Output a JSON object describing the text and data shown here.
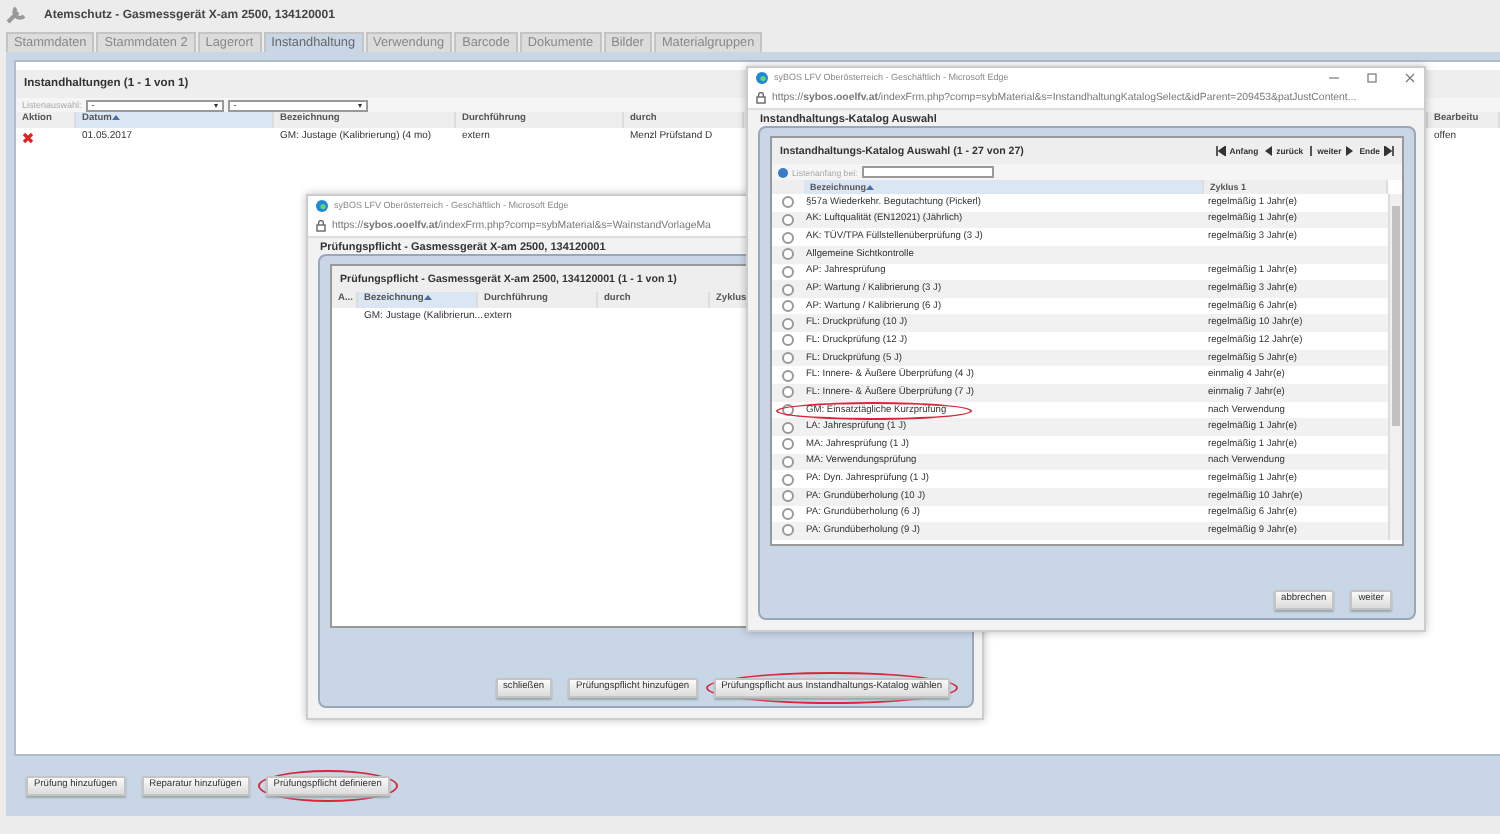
{
  "page": {
    "title": "Atemschutz - Gasmessgerät X-am 2500, 134120001"
  },
  "tabs": [
    {
      "label": "Stammdaten",
      "selected": false
    },
    {
      "label": "Stammdaten 2",
      "selected": false
    },
    {
      "label": "Lagerort",
      "selected": false
    },
    {
      "label": "Instandhaltung",
      "selected": true
    },
    {
      "label": "Verwendung",
      "selected": false
    },
    {
      "label": "Barcode",
      "selected": false
    },
    {
      "label": "Dokumente",
      "selected": false
    },
    {
      "label": "Bilder",
      "selected": false
    },
    {
      "label": "Materialgruppen",
      "selected": false
    }
  ],
  "maintenance": {
    "title": "Instandhaltungen (1 - 1 von 1)",
    "filter_label": "Listenauswahl:",
    "filter_1": "-",
    "filter_2": "-",
    "columns": [
      {
        "label": "Aktion",
        "sorted": false
      },
      {
        "label": "Datum",
        "sorted": true
      },
      {
        "label": "Bezeichnung",
        "sorted": false
      },
      {
        "label": "Durchführung",
        "sorted": false
      },
      {
        "label": "durch",
        "sorted": false
      },
      {
        "label": "Bearbeitu",
        "sorted": false
      }
    ],
    "rows": [
      {
        "datum": "01.05.2017",
        "bezeichnung": "GM: Justage (Kalibrierung) (4 mo)",
        "durchfuehrung": "extern",
        "durch": "Menzl Prüfstand D",
        "bearbeitung": "offen"
      }
    ]
  },
  "buttons": [
    {
      "label": "Prüfung hinzufügen",
      "highlighted": false
    },
    {
      "label": "Reparatur hinzufügen",
      "highlighted": false
    },
    {
      "label": "Prüfungspflicht definieren",
      "highlighted": true
    }
  ],
  "duty_window": {
    "title": "syBOS LFV Oberösterreich - Geschäftlich - Microsoft Edge",
    "url": "https://**sybos.ooelfv.at**/indexFrm.php?comp=sybMaterial&s=WainstandVorlageMa",
    "legend": "Prüfungspflicht - Gasmessgerät X-am 2500, 134120001",
    "list_title": "Prüfungspflicht - Gasmessgerät X-am 2500, 134120001 (1 - 1 von 1)",
    "columns": [
      {
        "label": "A...",
        "sorted": false
      },
      {
        "label": "Bezeichnung",
        "sorted": true
      },
      {
        "label": "Durchführung",
        "sorted": false
      },
      {
        "label": "durch",
        "sorted": false
      },
      {
        "label": "Zyklus",
        "sorted": false
      }
    ],
    "rows": [
      {
        "bezeichnung": "GM: Justage (Kalibrierun...",
        "durchfuehrung": "extern"
      }
    ],
    "buttons": [
      {
        "label": "schließen",
        "highlighted": false
      },
      {
        "label": "Prüfungspflicht hinzufügen",
        "highlighted": false
      },
      {
        "label": "Prüfungspflicht aus Instandhaltungs-Katalog wählen",
        "highlighted": true
      }
    ]
  },
  "catalog_window": {
    "title": "syBOS LFV Oberösterreich - Geschäftlich - Microsoft Edge",
    "url": "https://**sybos.ooelfv.at**/indexFrm.php?comp=sybMaterial&s=InstandhaltungKatalogSelect&idParent=209453&patJustContent...",
    "legend": "Instandhaltungs-Katalog Auswahl",
    "list_title": "Instandhaltungs-Katalog Auswahl (1 - 27 von 27)",
    "pager": {
      "first": "Anfang",
      "prev": "zurück",
      "next": "weiter",
      "last": "Ende"
    },
    "search_label": "Listenanfang bei:",
    "columns": [
      {
        "label": "Bezeichnung",
        "sorted": true
      },
      {
        "label": "Zyklus 1",
        "sorted": false
      }
    ],
    "rows": [
      {
        "name": "§57a Wiederkehr. Begutachtung (Pickerl)",
        "cycle": "regelmäßig 1 Jahr(e)",
        "selected": false,
        "highlighted": false
      },
      {
        "name": "AK: Luftqualität (EN12021) (Jährlich)",
        "cycle": "regelmäßig 1 Jahr(e)",
        "selected": false,
        "highlighted": false
      },
      {
        "name": "AK: TÜV/TPA Füllstellenüberprüfung (3 J)",
        "cycle": "regelmäßig 3 Jahr(e)",
        "selected": false,
        "highlighted": false
      },
      {
        "name": "Allgemeine Sichtkontrolle",
        "selected": false,
        "highlighted": false
      },
      {
        "name": "AP: Jahresprüfung",
        "cycle": "regelmäßig 1 Jahr(e)",
        "selected": false,
        "highlighted": false
      },
      {
        "name": "AP: Wartung / Kalibrierung (3 J)",
        "cycle": "regelmäßig 3 Jahr(e)",
        "selected": false,
        "highlighted": false
      },
      {
        "name": "AP: Wartung / Kalibrierung (6 J)",
        "cycle": "regelmäßig 6 Jahr(e)",
        "selected": false,
        "highlighted": false
      },
      {
        "name": "FL: Druckprüfung (10 J)",
        "cycle": "regelmäßig 10 Jahr(e)",
        "selected": false,
        "highlighted": false
      },
      {
        "name": "FL: Druckprüfung (12 J)",
        "cycle": "regelmäßig 12 Jahr(e)",
        "selected": false,
        "highlighted": false
      },
      {
        "name": "FL: Druckprüfung (5 J)",
        "cycle": "regelmäßig 5 Jahr(e)",
        "selected": false,
        "highlighted": false
      },
      {
        "name": "FL: Innere- & Äußere Überprüfung (4 J)",
        "cycle": "einmalig 4 Jahr(e)",
        "selected": false,
        "highlighted": false
      },
      {
        "name": "FL: Innere- & Äußere Überprüfung (7 J)",
        "cycle": "einmalig 7 Jahr(e)",
        "selected": false,
        "highlighted": false
      },
      {
        "name": "GM: Einsatztägliche Kurzprüfung",
        "cycle": "nach Verwendung",
        "selected": false,
        "highlighted": true
      },
      {
        "name": "LA: Jahresprüfung (1 J)",
        "cycle": "regelmäßig 1 Jahr(e)",
        "selected": false,
        "highlighted": false
      },
      {
        "name": "MA: Jahresprüfung (1 J)",
        "cycle": "regelmäßig 1 Jahr(e)",
        "selected": false,
        "highlighted": false
      },
      {
        "name": "MA: Verwendungsprüfung",
        "cycle": "nach Verwendung",
        "selected": false,
        "highlighted": false
      },
      {
        "name": "PA: Dyn. Jahresprüfung (1 J)",
        "cycle": "regelmäßig 1 Jahr(e)",
        "selected": false,
        "highlighted": false
      },
      {
        "name": "PA: Grundüberholung (10 J)",
        "cycle": "regelmäßig 10 Jahr(e)",
        "selected": false,
        "highlighted": false
      },
      {
        "name": "PA: Grundüberholung (6 J)",
        "cycle": "regelmäßig 6 Jahr(e)",
        "selected": false,
        "highlighted": false
      },
      {
        "name": "PA: Grundüberholung (9 J)",
        "cycle": "regelmäßig 9 Jahr(e)",
        "selected": false,
        "highlighted": false
      }
    ],
    "buttons": [
      {
        "label": "abbrechen",
        "highlighted": false
      },
      {
        "label": "weiter",
        "highlighted": false
      }
    ]
  }
}
